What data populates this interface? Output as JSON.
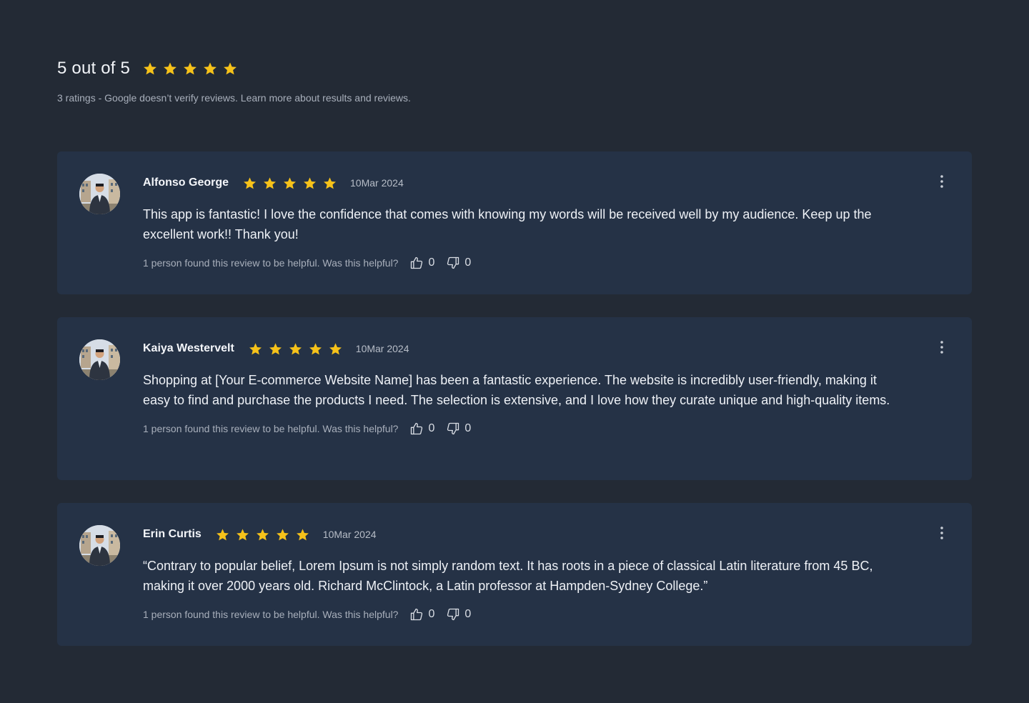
{
  "colors": {
    "background": "#232a35",
    "card": "#253246",
    "star": "#f6c21a"
  },
  "summary": {
    "title": "5 out of 5",
    "rating": 5,
    "subtitle": "3 ratings - Google doesn’t verify reviews. Learn more about results and reviews."
  },
  "reviews": [
    {
      "name": "Alfonso George",
      "rating": 5,
      "date": "10Mar 2024",
      "text": "This app is fantastic! I love the confidence that comes with knowing my words will be received well by my audience. Keep up the excellent work!! Thank you!",
      "helpful_text": "1 person found this review to be helpful. Was this helpful?",
      "likes": "0",
      "dislikes": "0",
      "avatar_icon": "user-avatar",
      "menu_icon": "more-vertical-icon"
    },
    {
      "name": "Kaiya Westervelt",
      "rating": 5,
      "date": "10Mar 2024",
      "text": "Shopping at [Your E-commerce Website Name] has been a fantastic experience. The website is incredibly user-friendly, making it easy to find and purchase the products I need. The selection is extensive, and I love how they curate unique and high-quality items.",
      "helpful_text": "1 person found this review to be helpful. Was this helpful?",
      "likes": "0",
      "dislikes": "0",
      "avatar_icon": "user-avatar",
      "menu_icon": "more-vertical-icon"
    },
    {
      "name": "Erin Curtis",
      "rating": 5,
      "date": "10Mar 2024",
      "text": "“Contrary to popular belief, Lorem Ipsum is not simply random text. It has roots in a piece of classical Latin literature from 45 BC, making it over 2000 years old. Richard McClintock, a Latin professor at Hampden-Sydney College.”",
      "helpful_text": "1 person found this review to be helpful. Was this helpful?",
      "likes": "0",
      "dislikes": "0",
      "avatar_icon": "user-avatar",
      "menu_icon": "more-vertical-icon"
    }
  ]
}
